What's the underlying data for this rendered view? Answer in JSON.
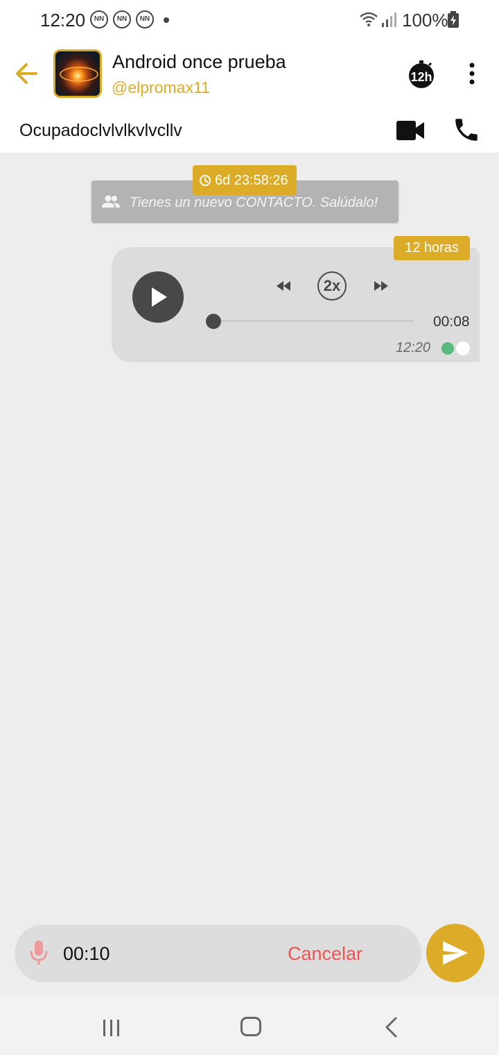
{
  "status_bar": {
    "time": "12:20",
    "notification_icon_label": "NN",
    "battery": "100%"
  },
  "header": {
    "contact_name": "Android once prueba",
    "handle": "@elpromax11",
    "status": "Ocupadoclvlvlkvlvcllv",
    "timer_icon_label": "12h",
    "accent_color": "#dcab27"
  },
  "chat": {
    "system_message": {
      "countdown": "6d 23:58:26",
      "text": "Tienes un nuevo CONTACTO. Salúdalo!"
    },
    "voice_message": {
      "expiry": "12 horas",
      "speed": "2x",
      "duration": "00:08",
      "time": "12:20",
      "progress": 0
    }
  },
  "recorder": {
    "elapsed": "00:10",
    "cancel_label": "Cancelar"
  }
}
